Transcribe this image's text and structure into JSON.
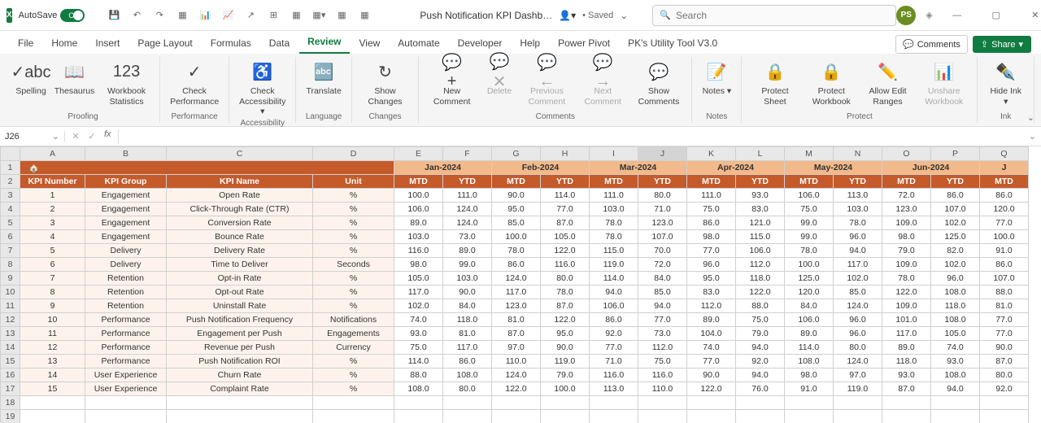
{
  "titlebar": {
    "autosave_label": "AutoSave",
    "autosave_state": "On",
    "doc_title": "Push Notification KPI Dashb…",
    "saved_label": "• Saved",
    "search_placeholder": "Search",
    "avatar_initials": "PS"
  },
  "tabs": [
    "File",
    "Home",
    "Insert",
    "Page Layout",
    "Formulas",
    "Data",
    "Review",
    "View",
    "Automate",
    "Developer",
    "Help",
    "Power Pivot",
    "PK's Utility Tool V3.0"
  ],
  "active_tab": "Review",
  "tab_right": {
    "comments": "Comments",
    "share": "Share"
  },
  "ribbon": {
    "groups": [
      {
        "label": "Proofing",
        "items": [
          {
            "label": "Spelling",
            "icon": "✓abc"
          },
          {
            "label": "Thesaurus",
            "icon": "📖"
          },
          {
            "label": "Workbook Statistics",
            "icon": "123"
          }
        ]
      },
      {
        "label": "Performance",
        "items": [
          {
            "label": "Check Performance",
            "icon": "✓"
          }
        ]
      },
      {
        "label": "Accessibility",
        "items": [
          {
            "label": "Check Accessibility",
            "icon": "♿",
            "dropdown": true
          }
        ]
      },
      {
        "label": "Language",
        "items": [
          {
            "label": "Translate",
            "icon": "🔤"
          }
        ]
      },
      {
        "label": "Changes",
        "items": [
          {
            "label": "Show Changes",
            "icon": "↻"
          }
        ]
      },
      {
        "label": "Comments",
        "items": [
          {
            "label": "New Comment",
            "icon": "💬+"
          },
          {
            "label": "Delete",
            "icon": "💬✕",
            "disabled": true
          },
          {
            "label": "Previous Comment",
            "icon": "💬←",
            "disabled": true
          },
          {
            "label": "Next Comment",
            "icon": "💬→",
            "disabled": true
          },
          {
            "label": "Show Comments",
            "icon": "💬"
          }
        ]
      },
      {
        "label": "Notes",
        "items": [
          {
            "label": "Notes",
            "icon": "📝",
            "dropdown": true
          }
        ]
      },
      {
        "label": "Protect",
        "items": [
          {
            "label": "Protect Sheet",
            "icon": "🔒"
          },
          {
            "label": "Protect Workbook",
            "icon": "🔒"
          },
          {
            "label": "Allow Edit Ranges",
            "icon": "✏️"
          },
          {
            "label": "Unshare Workbook",
            "icon": "📊",
            "disabled": true
          }
        ]
      },
      {
        "label": "Ink",
        "items": [
          {
            "label": "Hide Ink",
            "icon": "✒️",
            "dropdown": true
          }
        ]
      }
    ]
  },
  "formula_bar": {
    "name_box": "J26",
    "formula": ""
  },
  "grid": {
    "columns": [
      "A",
      "B",
      "C",
      "D",
      "E",
      "F",
      "G",
      "H",
      "I",
      "J",
      "K",
      "L",
      "M",
      "N",
      "O",
      "P",
      "Q"
    ],
    "active_col": "J",
    "col_widths": {
      "A": "col-A",
      "B": "col-B",
      "C": "col-C",
      "D": "col-D"
    },
    "months": [
      "Jan-2024",
      "Feb-2024",
      "Mar-2024",
      "Apr-2024",
      "May-2024",
      "Jun-2024",
      "J"
    ],
    "kpi_headers": [
      "KPI Number",
      "KPI Group",
      "KPI Name",
      "Unit"
    ],
    "mtd_ytd": [
      "MTD",
      "YTD",
      "MTD",
      "YTD",
      "MTD",
      "YTD",
      "MTD",
      "YTD",
      "MTD",
      "YTD",
      "MTD",
      "YTD",
      "MTD"
    ],
    "rows": [
      {
        "num": "1",
        "group": "Engagement",
        "name": "Open Rate",
        "unit": "%",
        "data": [
          "100.0",
          "111.0",
          "90.0",
          "114.0",
          "111.0",
          "80.0",
          "111.0",
          "93.0",
          "106.0",
          "113.0",
          "72.0",
          "86.0",
          "86.0"
        ]
      },
      {
        "num": "2",
        "group": "Engagement",
        "name": "Click-Through Rate (CTR)",
        "unit": "%",
        "data": [
          "106.0",
          "124.0",
          "95.0",
          "77.0",
          "103.0",
          "71.0",
          "75.0",
          "83.0",
          "75.0",
          "103.0",
          "123.0",
          "107.0",
          "120.0"
        ]
      },
      {
        "num": "3",
        "group": "Engagement",
        "name": "Conversion Rate",
        "unit": "%",
        "data": [
          "89.0",
          "124.0",
          "85.0",
          "87.0",
          "78.0",
          "123.0",
          "86.0",
          "121.0",
          "99.0",
          "78.0",
          "109.0",
          "102.0",
          "77.0"
        ]
      },
      {
        "num": "4",
        "group": "Engagement",
        "name": "Bounce Rate",
        "unit": "%",
        "data": [
          "103.0",
          "73.0",
          "100.0",
          "105.0",
          "78.0",
          "107.0",
          "98.0",
          "115.0",
          "99.0",
          "96.0",
          "98.0",
          "125.0",
          "100.0"
        ]
      },
      {
        "num": "5",
        "group": "Delivery",
        "name": "Delivery Rate",
        "unit": "%",
        "data": [
          "116.0",
          "89.0",
          "78.0",
          "122.0",
          "115.0",
          "70.0",
          "77.0",
          "106.0",
          "78.0",
          "94.0",
          "79.0",
          "82.0",
          "91.0"
        ]
      },
      {
        "num": "6",
        "group": "Delivery",
        "name": "Time to Deliver",
        "unit": "Seconds",
        "data": [
          "98.0",
          "99.0",
          "86.0",
          "116.0",
          "119.0",
          "72.0",
          "96.0",
          "112.0",
          "100.0",
          "117.0",
          "109.0",
          "102.0",
          "86.0"
        ]
      },
      {
        "num": "7",
        "group": "Retention",
        "name": "Opt-in Rate",
        "unit": "%",
        "data": [
          "105.0",
          "103.0",
          "124.0",
          "80.0",
          "114.0",
          "84.0",
          "95.0",
          "118.0",
          "125.0",
          "102.0",
          "78.0",
          "96.0",
          "107.0"
        ]
      },
      {
        "num": "8",
        "group": "Retention",
        "name": "Opt-out Rate",
        "unit": "%",
        "data": [
          "117.0",
          "90.0",
          "117.0",
          "78.0",
          "94.0",
          "85.0",
          "83.0",
          "122.0",
          "120.0",
          "85.0",
          "122.0",
          "108.0",
          "88.0"
        ]
      },
      {
        "num": "9",
        "group": "Retention",
        "name": "Uninstall Rate",
        "unit": "%",
        "data": [
          "102.0",
          "84.0",
          "123.0",
          "87.0",
          "106.0",
          "94.0",
          "112.0",
          "88.0",
          "84.0",
          "124.0",
          "109.0",
          "118.0",
          "81.0"
        ]
      },
      {
        "num": "10",
        "group": "Performance",
        "name": "Push Notification Frequency",
        "unit": "Notifications",
        "data": [
          "74.0",
          "118.0",
          "81.0",
          "122.0",
          "86.0",
          "77.0",
          "89.0",
          "75.0",
          "106.0",
          "96.0",
          "101.0",
          "108.0",
          "77.0"
        ]
      },
      {
        "num": "11",
        "group": "Performance",
        "name": "Engagement per Push",
        "unit": "Engagements",
        "data": [
          "93.0",
          "81.0",
          "87.0",
          "95.0",
          "92.0",
          "73.0",
          "104.0",
          "79.0",
          "89.0",
          "96.0",
          "117.0",
          "105.0",
          "77.0"
        ]
      },
      {
        "num": "12",
        "group": "Performance",
        "name": "Revenue per Push",
        "unit": "Currency",
        "data": [
          "75.0",
          "117.0",
          "97.0",
          "90.0",
          "77.0",
          "112.0",
          "74.0",
          "94.0",
          "114.0",
          "80.0",
          "89.0",
          "74.0",
          "90.0"
        ]
      },
      {
        "num": "13",
        "group": "Performance",
        "name": "Push Notification ROI",
        "unit": "%",
        "data": [
          "114.0",
          "86.0",
          "110.0",
          "119.0",
          "71.0",
          "75.0",
          "77.0",
          "92.0",
          "108.0",
          "124.0",
          "118.0",
          "93.0",
          "87.0"
        ]
      },
      {
        "num": "14",
        "group": "User Experience",
        "name": "Churn Rate",
        "unit": "%",
        "data": [
          "88.0",
          "108.0",
          "124.0",
          "79.0",
          "116.0",
          "116.0",
          "90.0",
          "94.0",
          "98.0",
          "97.0",
          "93.0",
          "108.0",
          "80.0"
        ]
      },
      {
        "num": "15",
        "group": "User Experience",
        "name": "Complaint Rate",
        "unit": "%",
        "data": [
          "108.0",
          "80.0",
          "122.0",
          "100.0",
          "113.0",
          "110.0",
          "122.0",
          "76.0",
          "91.0",
          "119.0",
          "87.0",
          "94.0",
          "92.0"
        ]
      }
    ],
    "empty_rows": [
      18,
      19
    ]
  }
}
